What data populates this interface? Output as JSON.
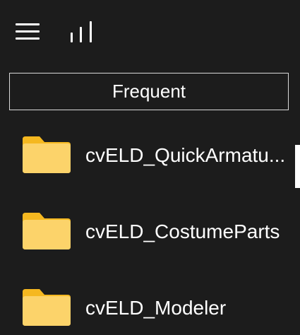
{
  "toolbar": {
    "menu_icon": "hamburger-menu-icon",
    "sort_icon": "bar-chart-icon"
  },
  "frequent_button": {
    "label": "Frequent"
  },
  "items": [
    {
      "label": "cvELD_QuickArmatu...",
      "icon": "folder-icon"
    },
    {
      "label": "cvELD_CostumeParts",
      "icon": "folder-icon"
    },
    {
      "label": "cvELD_Modeler",
      "icon": "folder-icon"
    }
  ],
  "colors": {
    "background": "#1c1c1c",
    "text": "#ffffff",
    "folder_front": "#fcd36a",
    "folder_back": "#f5b820",
    "border": "#d9d9d9"
  }
}
